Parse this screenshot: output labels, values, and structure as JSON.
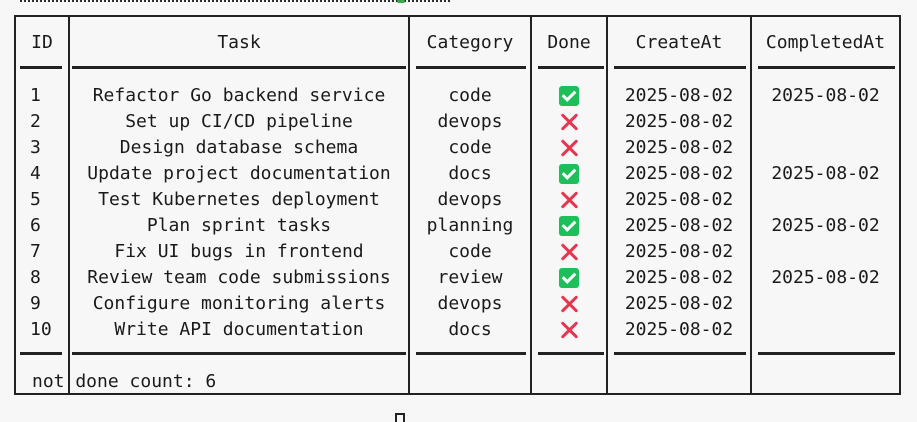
{
  "headers": {
    "id": "ID",
    "task": "Task",
    "category": "Category",
    "done": "Done",
    "created": "CreateAt",
    "completed": "CompletedAt"
  },
  "rows": [
    {
      "id": "1",
      "task": "Refactor Go backend service",
      "category": "code",
      "done": true,
      "created": "2025-08-02",
      "completed": "2025-08-02"
    },
    {
      "id": "2",
      "task": "Set up CI/CD pipeline",
      "category": "devops",
      "done": false,
      "created": "2025-08-02",
      "completed": ""
    },
    {
      "id": "3",
      "task": "Design database schema",
      "category": "code",
      "done": false,
      "created": "2025-08-02",
      "completed": ""
    },
    {
      "id": "4",
      "task": "Update project documentation",
      "category": "docs",
      "done": true,
      "created": "2025-08-02",
      "completed": "2025-08-02"
    },
    {
      "id": "5",
      "task": "Test Kubernetes deployment",
      "category": "devops",
      "done": false,
      "created": "2025-08-02",
      "completed": ""
    },
    {
      "id": "6",
      "task": "Plan sprint tasks",
      "category": "planning",
      "done": true,
      "created": "2025-08-02",
      "completed": "2025-08-02"
    },
    {
      "id": "7",
      "task": "Fix UI bugs in frontend",
      "category": "code",
      "done": false,
      "created": "2025-08-02",
      "completed": ""
    },
    {
      "id": "8",
      "task": "Review team code submissions",
      "category": "review",
      "done": true,
      "created": "2025-08-02",
      "completed": "2025-08-02"
    },
    {
      "id": "9",
      "task": "Configure monitoring alerts",
      "category": "devops",
      "done": false,
      "created": "2025-08-02",
      "completed": ""
    },
    {
      "id": "10",
      "task": "Write API documentation",
      "category": "docs",
      "done": false,
      "created": "2025-08-02",
      "completed": ""
    }
  ],
  "footer": {
    "text": "not done count: 6"
  },
  "icons": {
    "done": "check-icon",
    "not_done": "cross-icon"
  },
  "colors": {
    "check": "#1dbf5a",
    "cross": "#e8344d"
  }
}
